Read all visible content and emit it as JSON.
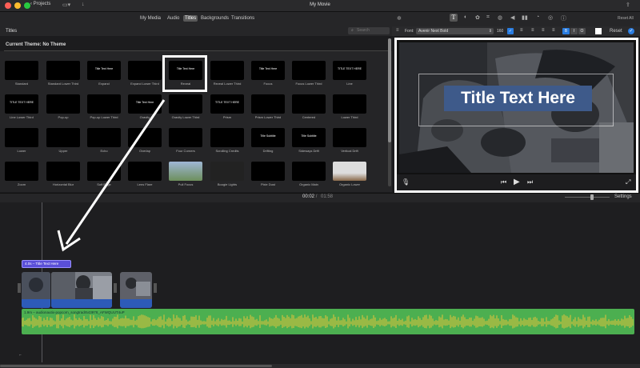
{
  "window": {
    "title": "My Movie",
    "projects_label": "Projects"
  },
  "browser": {
    "tabs": [
      {
        "label": "My Media"
      },
      {
        "label": "Audio"
      },
      {
        "label": "Titles",
        "active": true
      },
      {
        "label": "Backgrounds"
      },
      {
        "label": "Transitions"
      }
    ],
    "section_title": "Titles",
    "search_placeholder": "Search",
    "theme_label": "Current Theme: No Theme",
    "tiles": [
      {
        "label": "Standard",
        "preview": ""
      },
      {
        "label": "Standard Lower Third",
        "preview": ""
      },
      {
        "label": "Expand",
        "preview": "Title Text Here"
      },
      {
        "label": "Expand Lower Third",
        "preview": ""
      },
      {
        "label": "Reveal",
        "preview": "Title Text Here"
      },
      {
        "label": "Reveal Lower Third",
        "preview": ""
      },
      {
        "label": "Focus",
        "preview": "Title Text Here"
      },
      {
        "label": "Focus Lower Third",
        "preview": ""
      },
      {
        "label": "Line",
        "preview": "TITLE TEXT HERE"
      },
      {
        "label": "Line Lower Third",
        "preview": "TITLE TEXT HERE"
      },
      {
        "label": "Pop-up",
        "preview": ""
      },
      {
        "label": "Pop-up Lower Third",
        "preview": ""
      },
      {
        "label": "Gravity",
        "preview": "Title Text Here"
      },
      {
        "label": "Gravity Lower Third",
        "preview": ""
      },
      {
        "label": "Prism",
        "preview": "TITLE TEXT HERE"
      },
      {
        "label": "Prism Lower Third",
        "preview": ""
      },
      {
        "label": "Centered",
        "preview": ""
      },
      {
        "label": "Lower Third",
        "preview": ""
      },
      {
        "label": "Lower",
        "preview": ""
      },
      {
        "label": "Upper",
        "preview": ""
      },
      {
        "label": "Echo",
        "preview": ""
      },
      {
        "label": "Overlap",
        "preview": ""
      },
      {
        "label": "Four Corners",
        "preview": ""
      },
      {
        "label": "Scrolling Credits",
        "preview": ""
      },
      {
        "label": "Drifting",
        "preview": "Title Subtitle"
      },
      {
        "label": "Sideways Drift",
        "preview": "Title Subtitle"
      },
      {
        "label": "Vertical Drift",
        "preview": ""
      },
      {
        "label": "Zoom",
        "preview": ""
      },
      {
        "label": "Horizontal Blur",
        "preview": ""
      },
      {
        "label": "Soft Edge",
        "preview": ""
      },
      {
        "label": "Lens Flare",
        "preview": ""
      },
      {
        "label": "Pull Focus",
        "preview": ""
      },
      {
        "label": "Boogie Lights",
        "preview": ""
      },
      {
        "label": "Pixie Dust",
        "preview": ""
      },
      {
        "label": "Organic Main",
        "preview": ""
      },
      {
        "label": "Organic Lower",
        "preview": ""
      }
    ]
  },
  "inspector": {
    "font_label": "Font:",
    "font_value": "Avenir Next Bold",
    "font_size": "160",
    "bold_label": "B",
    "italic_label": "I",
    "outline_label": "O",
    "reset_label": "Reset",
    "reset_all_label": "Reset All"
  },
  "viewer": {
    "title_text": "Title Text Here"
  },
  "timeline": {
    "timecode_current": "00:02",
    "timecode_sep": "/",
    "timecode_total": "01:58",
    "settings_label": "Settings",
    "title_clip_label": "4.0s – Title Text Here",
    "audio_label": "1.9m – audionautix-popcorn_songtradr543978_AFWQUUT4uP"
  },
  "colors": {
    "title_clip": "#5a4fd8",
    "audio_track": "#4caf50",
    "title_overlay": "#3e5a8a",
    "accent_blue": "#2a7de1"
  }
}
